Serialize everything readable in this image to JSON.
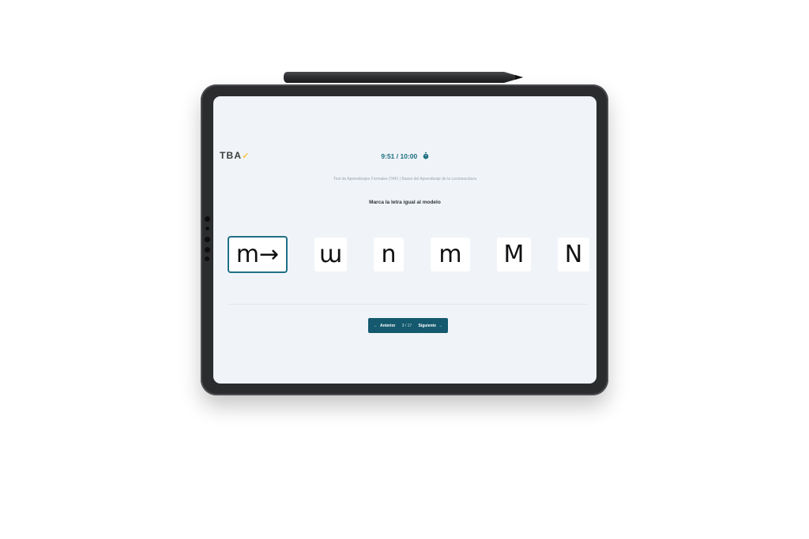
{
  "header": {
    "logo_text": "TBA",
    "timer": "9:51 / 10:00"
  },
  "subtitle": "Test de Aprendizajes Formales (TAF) | Bases del Aprendizaje de la Lectoescritura",
  "instruction": "Marca la letra igual al modelo",
  "model": {
    "label": "m→"
  },
  "options": [
    {
      "label": "ɯ"
    },
    {
      "label": "n"
    },
    {
      "label": "m"
    },
    {
      "label": "M"
    },
    {
      "label": "N"
    }
  ],
  "navigation": {
    "prev_label": "Anterior",
    "counter": "3 / 17",
    "next_label": "Siguiente"
  },
  "colors": {
    "accent": "#14596e",
    "timer": "#1c6e80",
    "logo_check": "#f4c542",
    "screen_bg": "#f0f4f8"
  }
}
